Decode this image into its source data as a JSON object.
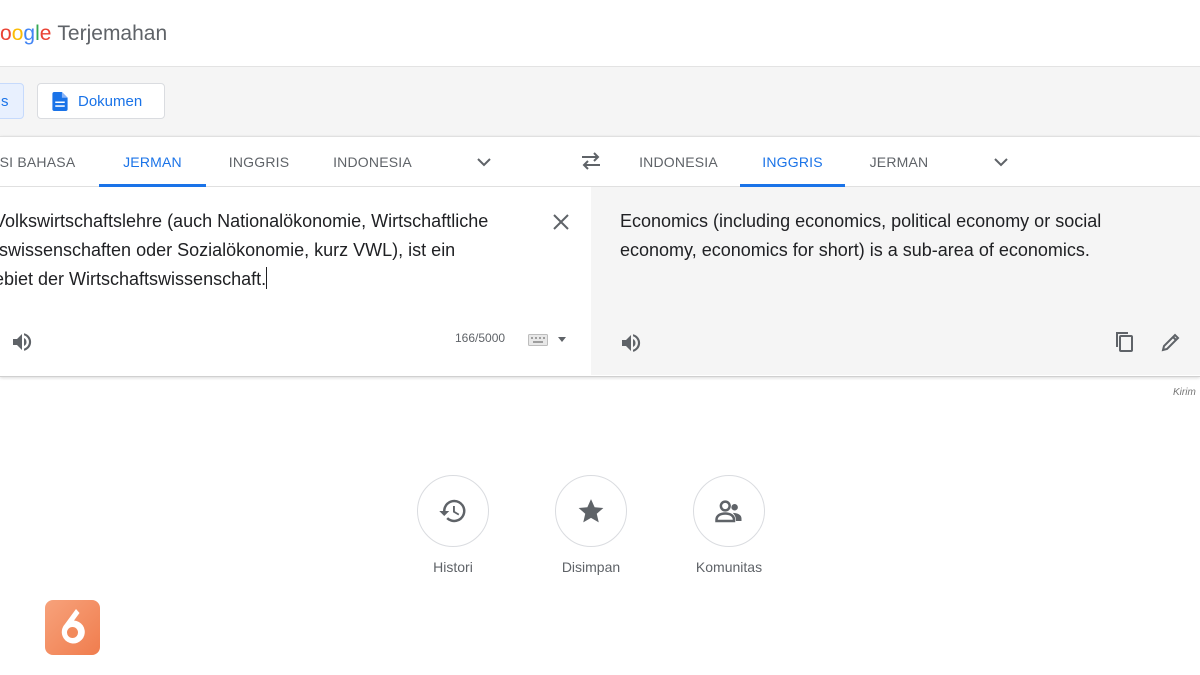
{
  "header": {
    "logo_letters": [
      "o",
      "o",
      "g",
      "l",
      "e"
    ],
    "app_name": "Terjemahan"
  },
  "modes": {
    "text_label": "s",
    "document_label": "Dokumen"
  },
  "source_tabs": [
    "SI BAHASA",
    "JERMAN",
    "INGGRIS",
    "INDONESIA"
  ],
  "target_tabs": [
    "INDONESIA",
    "INGGRIS",
    "JERMAN"
  ],
  "source": {
    "lines": [
      "Volkswirtschaftslehre (auch Nationalökonomie, Wirtschaftliche",
      "tswissenschaften oder Sozialökonomie, kurz VWL), ist ein",
      "ebiet der Wirtschaftswissenschaft."
    ],
    "char_count": "166/5000"
  },
  "target": {
    "lines": [
      "Economics (including economics, political economy or social",
      "economy, economics for short) is a sub-area of economics."
    ]
  },
  "feedback_label": "Kirim",
  "actions": [
    {
      "label": "Histori",
      "icon": "history-icon"
    },
    {
      "label": "Disimpan",
      "icon": "star-icon"
    },
    {
      "label": "Komunitas",
      "icon": "community-icon"
    }
  ],
  "colors": {
    "accent": "#1a73e8",
    "target_bg": "#f5f5f5",
    "watermark": "#f07d4e"
  }
}
